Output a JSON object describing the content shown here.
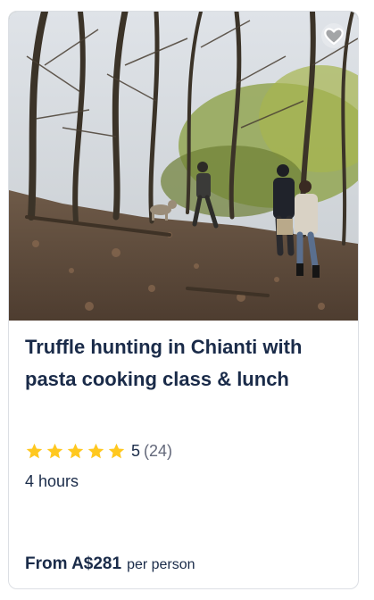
{
  "card": {
    "title": "Truffle hunting in Chianti with pasta cooking class & lunch",
    "rating": {
      "stars": 5,
      "value": "5",
      "count": "(24)"
    },
    "duration": "4 hours",
    "price": {
      "main": "From A$281",
      "unit": "per person"
    },
    "wishlist_icon": "heart-outline-icon",
    "colors": {
      "title": "#1a2b49",
      "star": "#ffc81f",
      "secondary_text": "#63687a"
    }
  }
}
